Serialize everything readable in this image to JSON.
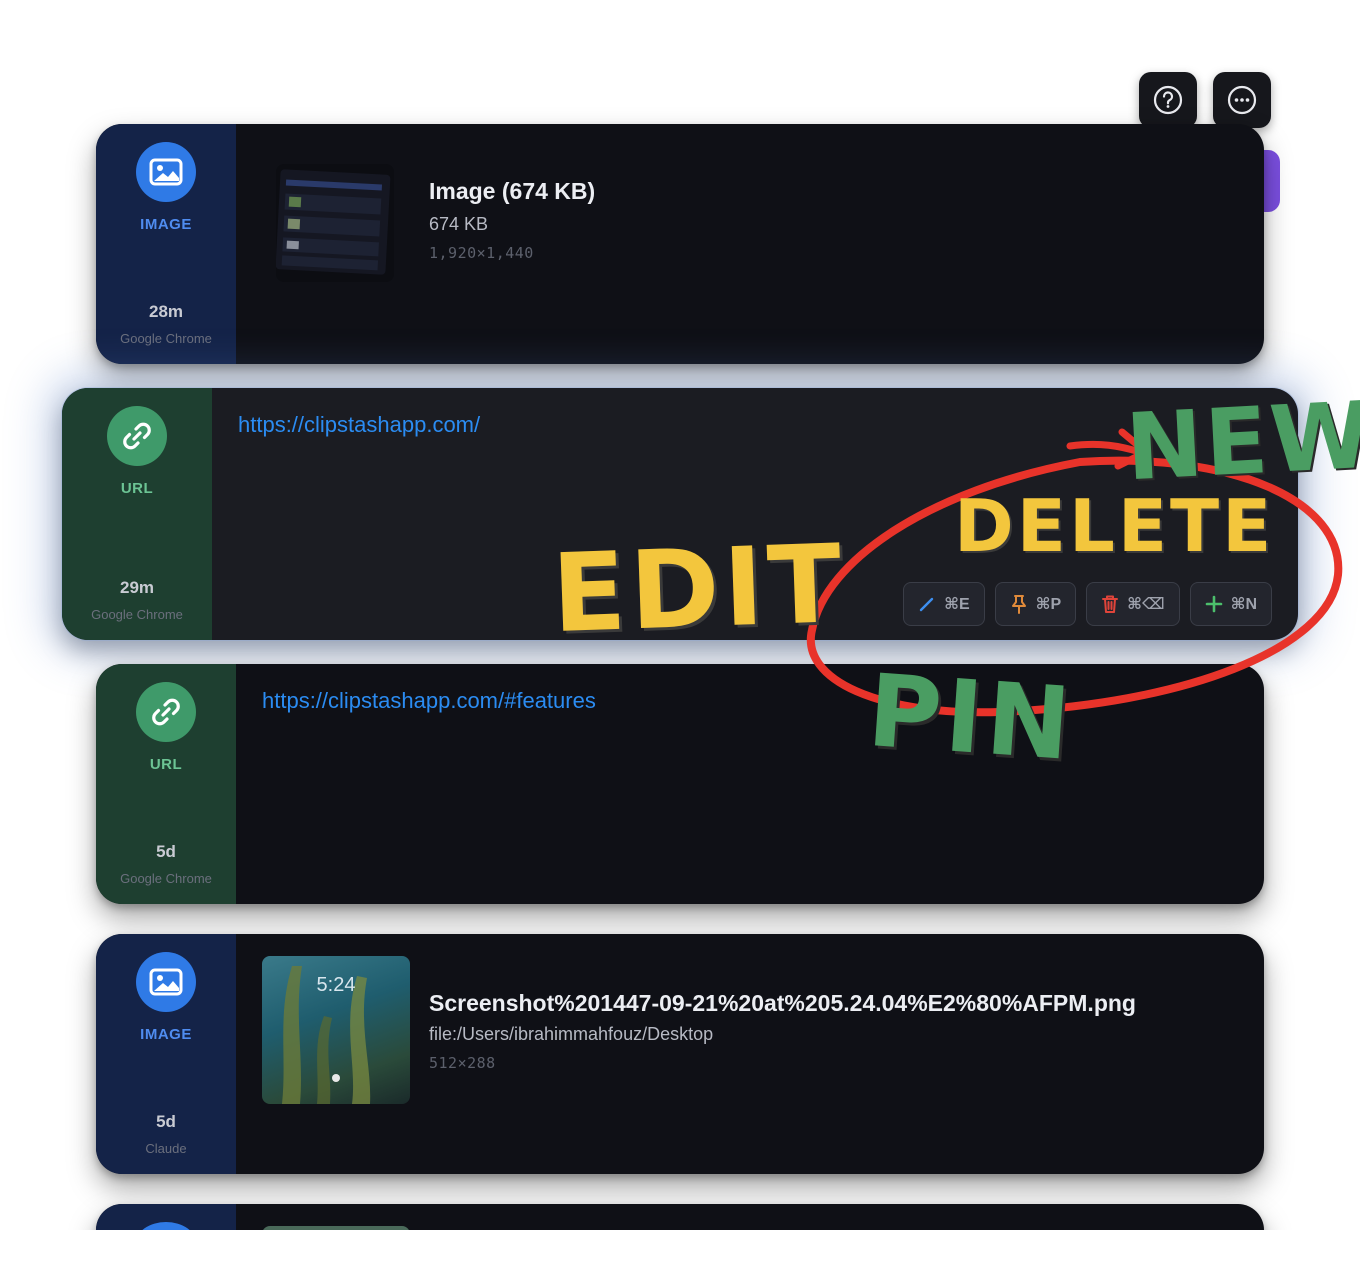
{
  "toolbar": {
    "help_icon": "question-circle-icon",
    "more_icon": "ellipsis-circle-icon"
  },
  "colors": {
    "image_accent": "#2f7ae6",
    "url_accent": "#3f9a6a",
    "link_color": "#2b8cf2",
    "annotation_red": "#e8332a",
    "annotation_yellow": "#f3c63d",
    "annotation_green": "#4a9d62"
  },
  "clips": [
    {
      "type_label": "IMAGE",
      "icon": "photo-icon",
      "age": "28m",
      "source": "Google Chrome",
      "title": "Image (674 KB)",
      "subtitle": "674 KB",
      "dimensions": "1,920×1,440"
    },
    {
      "type_label": "URL",
      "icon": "link-icon",
      "age": "29m",
      "source": "Google Chrome",
      "url": "https://clipstashapp.com/",
      "selected": true
    },
    {
      "type_label": "URL",
      "icon": "link-icon",
      "age": "5d",
      "source": "Google Chrome",
      "url": "https://clipstashapp.com/#features"
    },
    {
      "type_label": "IMAGE",
      "icon": "photo-icon",
      "age": "5d",
      "source": "Claude",
      "title": "Screenshot%201447-09-21%20at%205.24.04%E2%80%AFPM.png",
      "subtitle": "file:/Users/ibrahimmahfouz/Desktop",
      "dimensions": "512×288",
      "thumb_time": "5:24"
    }
  ],
  "actions": [
    {
      "icon": "pencil-icon",
      "shortcut": "⌘E",
      "color": "#3d8ff0"
    },
    {
      "icon": "pin-icon",
      "shortcut": "⌘P",
      "color": "#e08a3a"
    },
    {
      "icon": "trash-icon",
      "shortcut": "⌘⌫",
      "color": "#e0443a"
    },
    {
      "icon": "plus-icon",
      "shortcut": "⌘N",
      "color": "#4cbf6c"
    }
  ],
  "annotations": {
    "edit": "EDIT",
    "delete": "DELETE",
    "pin": "PIN",
    "new": "NEW"
  }
}
